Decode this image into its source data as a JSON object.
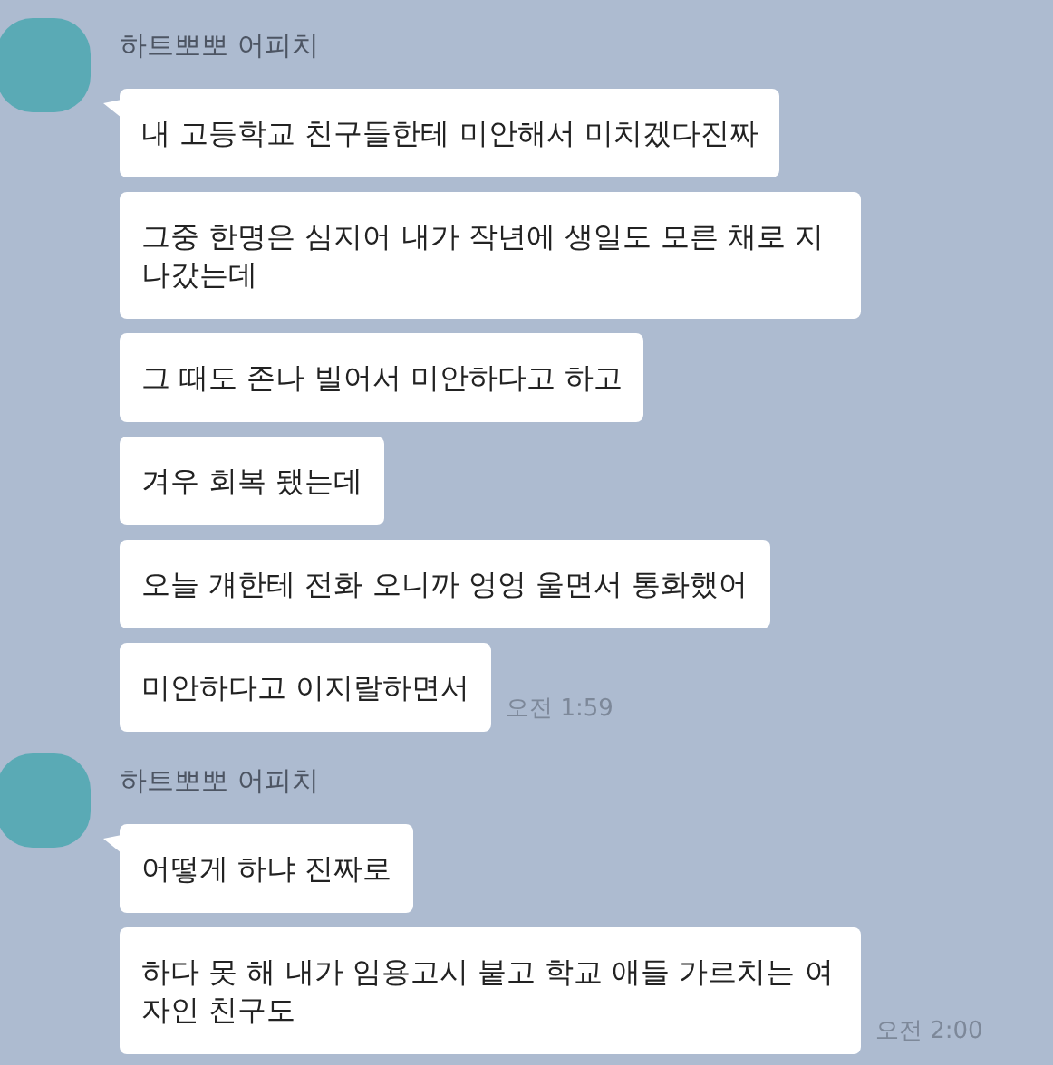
{
  "groups": [
    {
      "sender": "하트뽀뽀 어피치",
      "messages": [
        "내 고등학교 친구들한테 미안해서 미치겠다진짜",
        "그중 한명은 심지어 내가 작년에 생일도 모른 채로 지나갔는데",
        "그 때도 존나 빌어서 미안하다고 하고",
        "겨우 회복 됐는데",
        "오늘 걔한테 전화 오니까 엉엉 울면서 통화했어",
        "미안하다고 이지랄하면서"
      ],
      "time": "오전 1:59"
    },
    {
      "sender": "하트뽀뽀 어피치",
      "messages": [
        "어떻게 하냐 진짜로",
        "하다 못 해 내가 임용고시 붙고 학교 애들 가르치는 여자인 친구도"
      ],
      "time": "오전 2:00"
    }
  ]
}
